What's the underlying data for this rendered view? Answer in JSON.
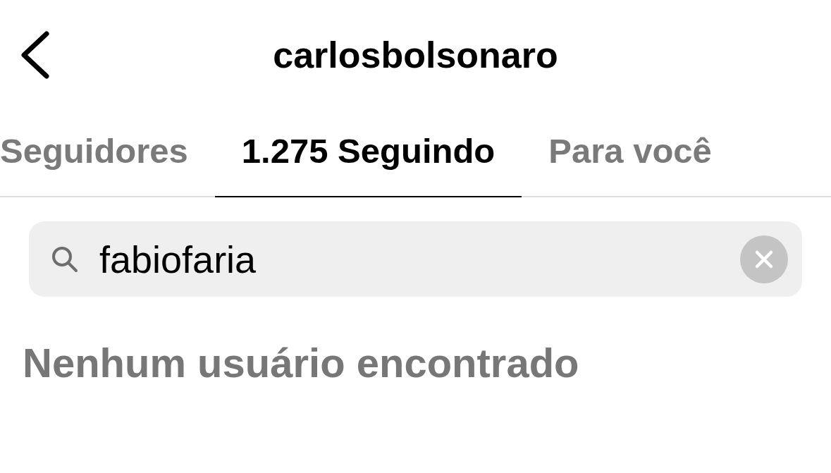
{
  "header": {
    "title": "carlosbolsonaro"
  },
  "tabs": [
    {
      "label": "Seguidores",
      "selected": false
    },
    {
      "label": "1.275 Seguindo",
      "selected": true
    },
    {
      "label": "Para você",
      "selected": false
    }
  ],
  "search": {
    "value": "fabiofaria"
  },
  "empty_message": "Nenhum usuário encontrado"
}
